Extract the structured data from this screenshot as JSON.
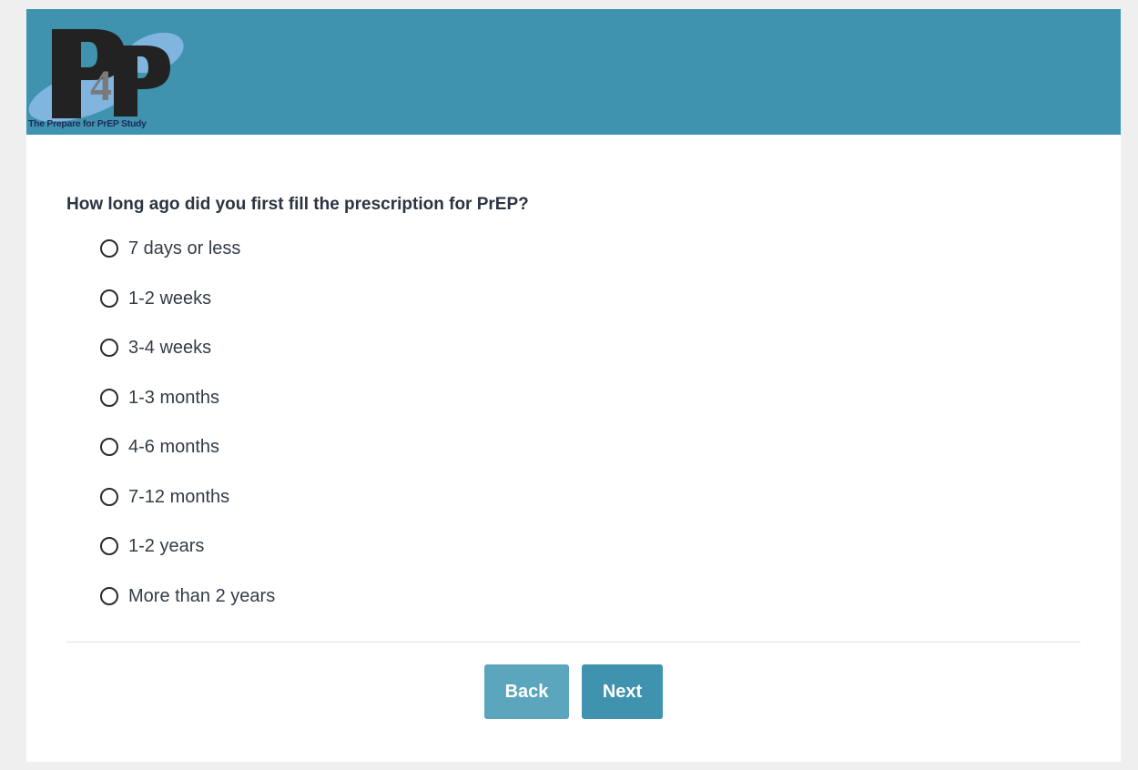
{
  "header": {
    "logo_text": "P4P",
    "logo_caption": "The Prepare for PrEP Study",
    "background_color": "#3f93ae"
  },
  "question": {
    "text": "How long ago did you first fill the prescription for PrEP?",
    "options": [
      {
        "label": "7 days or less",
        "selected": false
      },
      {
        "label": "1-2 weeks",
        "selected": false
      },
      {
        "label": "3-4 weeks",
        "selected": false
      },
      {
        "label": "1-3 months",
        "selected": false
      },
      {
        "label": "4-6 months",
        "selected": false
      },
      {
        "label": "7-12 months",
        "selected": false
      },
      {
        "label": "1-2 years",
        "selected": false
      },
      {
        "label": "More than 2 years",
        "selected": false
      }
    ]
  },
  "nav": {
    "back_label": "Back",
    "next_label": "Next"
  },
  "colors": {
    "accent": "#3f93ae",
    "back_button": "#5ca6bd",
    "page_background": "#efefef"
  }
}
